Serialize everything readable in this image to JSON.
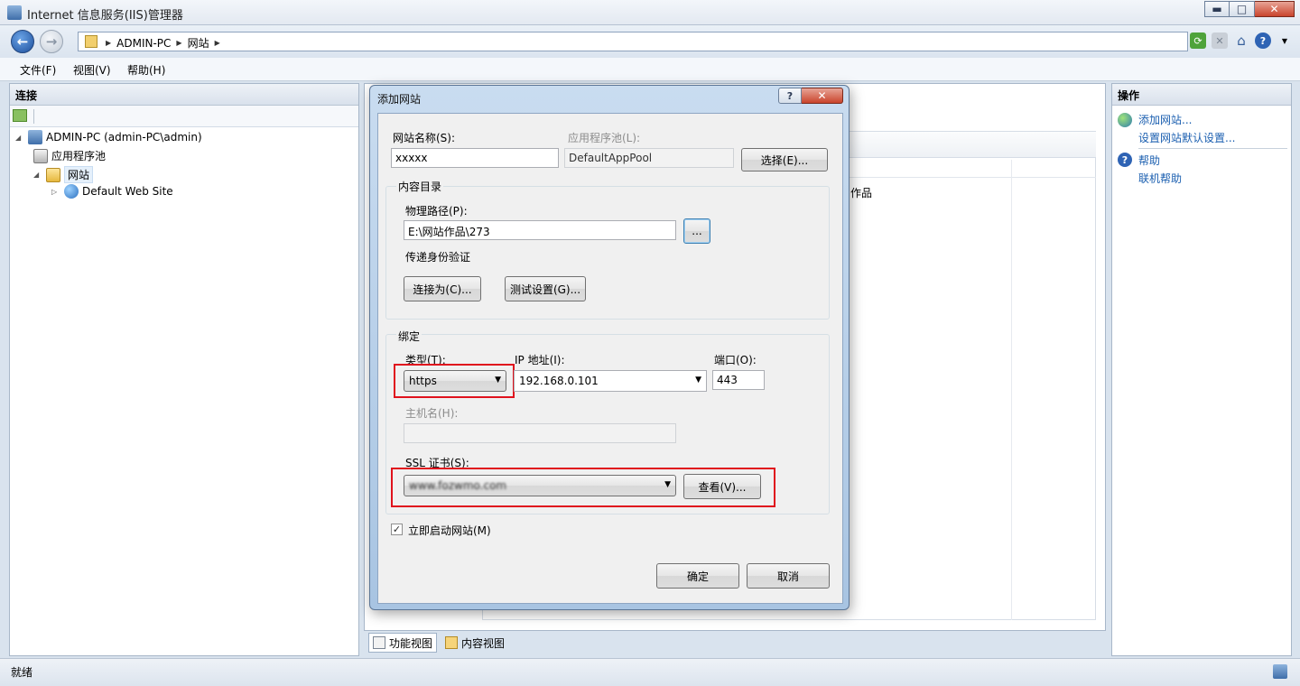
{
  "window": {
    "title": "Internet 信息服务(IIS)管理器",
    "min_glyph": "▬",
    "max_glyph": "□",
    "close_glyph": "✕"
  },
  "nav": {
    "back_glyph": "←",
    "forward_glyph": "→",
    "breadcrumbs": [
      "ADMIN-PC",
      "网站"
    ],
    "sep_glyph": "▶"
  },
  "menu": [
    "文件(F)",
    "视图(V)",
    "帮助(H)"
  ],
  "left_panel": {
    "header": "连接",
    "tree": {
      "root": "ADMIN-PC (admin-PC\\admin)",
      "app_pools": "应用程序池",
      "sites": "网站",
      "default_site": "Default Web Site"
    }
  },
  "center_panel": {
    "partial_text": "作品"
  },
  "bottom_tabs": {
    "features": "功能视图",
    "content": "内容视图"
  },
  "right_panel": {
    "header": "操作",
    "actions": {
      "add_site": "添加网站...",
      "site_defaults": "设置网站默认设置...",
      "help": "帮助",
      "online_help": "联机帮助"
    }
  },
  "status": {
    "text": "就绪"
  },
  "dialog": {
    "title": "添加网站",
    "help_glyph": "?",
    "close_glyph": "✕",
    "site_name_label": "网站名称(S):",
    "site_name_value": "xxxxx",
    "app_pool_label": "应用程序池(L):",
    "app_pool_value": "DefaultAppPool",
    "select_button": "选择(E)...",
    "content_dir_group": "内容目录",
    "physical_path_label": "物理路径(P):",
    "physical_path_value": "E:\\网站作品\\273",
    "browse_button": "...",
    "pass_through_label": "传递身份验证",
    "connect_as_button": "连接为(C)...",
    "test_settings_button": "测试设置(G)...",
    "binding_group": "绑定",
    "type_label": "类型(T):",
    "type_value": "https",
    "ip_label": "IP 地址(I):",
    "ip_value": "192.168.0.101",
    "port_label": "端口(O):",
    "port_value": "443",
    "hostname_label": "主机名(H):",
    "hostname_value": "",
    "ssl_label": "SSL 证书(S):",
    "ssl_value": "www.fozwmo.com",
    "view_button": "查看(V)...",
    "start_site_label": "立即启动网站(M)",
    "start_site_checked": true,
    "check_glyph": "✓",
    "ok_button": "确定",
    "cancel_button": "取消",
    "caret_glyph": "▼"
  },
  "colors": {
    "highlight_box": "#e0121d",
    "link": "#1b5fb0"
  }
}
